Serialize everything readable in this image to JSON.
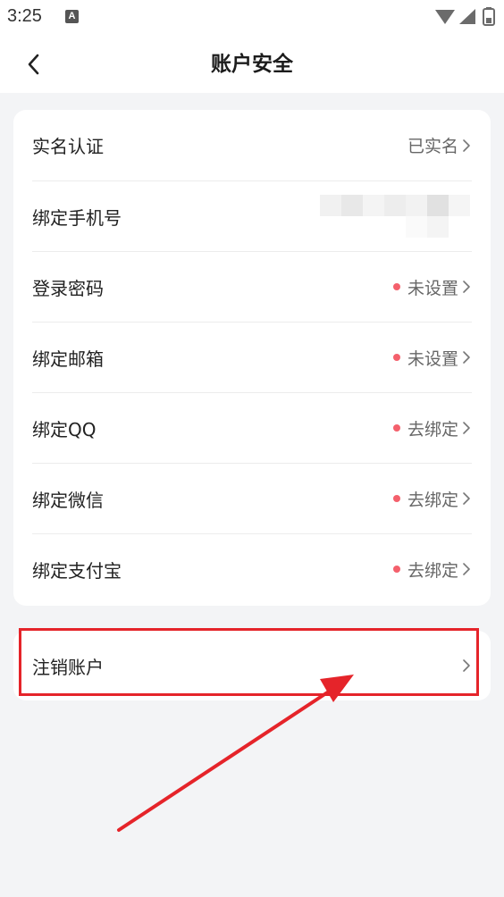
{
  "status_bar": {
    "time": "3:25",
    "notification_badge": "A"
  },
  "header": {
    "title": "账户安全",
    "back_icon": "chevron-left-icon"
  },
  "rows": [
    {
      "label": "实名认证",
      "value": "已实名",
      "dot": false
    },
    {
      "label": "绑定手机号",
      "value": "",
      "dot": false,
      "masked": true
    },
    {
      "label": "登录密码",
      "value": "未设置",
      "dot": true
    },
    {
      "label": "绑定邮箱",
      "value": "未设置",
      "dot": true
    },
    {
      "label": "绑定QQ",
      "value": "去绑定",
      "dot": true
    },
    {
      "label": "绑定微信",
      "value": "去绑定",
      "dot": true
    },
    {
      "label": "绑定支付宝",
      "value": "去绑定",
      "dot": true
    }
  ],
  "cancel_account": {
    "label": "注销账户"
  },
  "colors": {
    "background": "#f3f4f6",
    "card": "#ffffff",
    "dot": "#f4606c",
    "annotation": "#e5242a"
  }
}
